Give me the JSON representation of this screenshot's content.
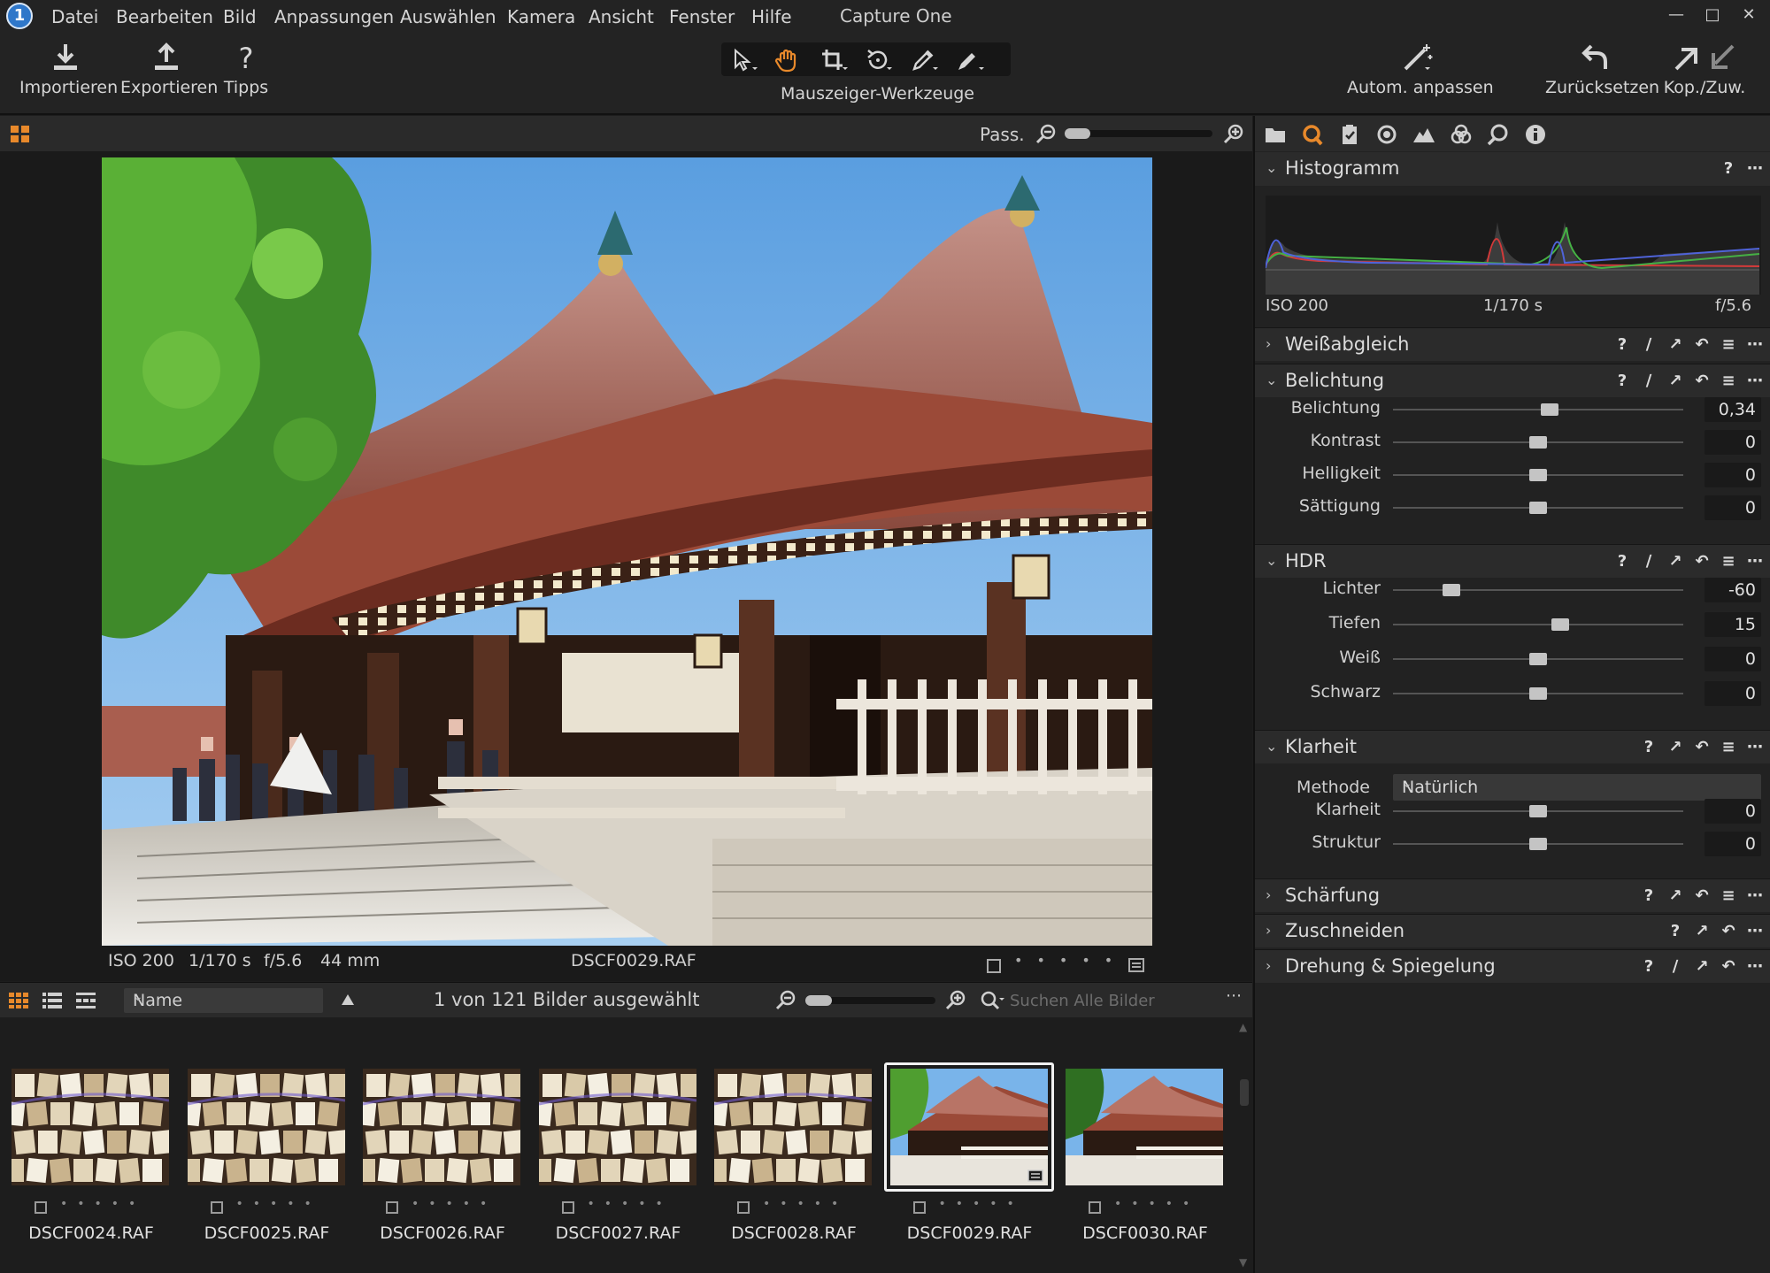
{
  "app": {
    "title": "Capture One",
    "logo": "1"
  },
  "menu": [
    "Datei",
    "Bearbeiten",
    "Bild",
    "Anpassungen",
    "Auswählen",
    "Kamera",
    "Ansicht",
    "Fenster",
    "Hilfe"
  ],
  "toolbar": {
    "import_label": "Importieren",
    "export_label": "Exportieren",
    "tips_label": "Tipps",
    "cursor_tools_label": "Mauszeiger-Werkzeuge",
    "auto_adjust_label": "Autom. anpassen",
    "reset_label": "Zurücksetzen",
    "copy_apply_label": "Kop./Zuw."
  },
  "viewer": {
    "fit_label": "Pass.",
    "zoom_level": 0.15,
    "info": {
      "iso": "ISO 200",
      "shutter": "1/170 s",
      "aperture": "f/5.6",
      "focal": "44 mm",
      "filename": "DSCF0029.RAF"
    }
  },
  "browser": {
    "sort_by": "Name",
    "selection_count": "1 von 121 Bilder ausgewählt",
    "search_placeholder": "Suchen Alle Bilder",
    "thumb_size": 0.15,
    "thumbnails": [
      {
        "name": "DSCF0024.RAF",
        "kind": "plaques"
      },
      {
        "name": "DSCF0025.RAF",
        "kind": "plaques"
      },
      {
        "name": "DSCF0026.RAF",
        "kind": "plaques"
      },
      {
        "name": "DSCF0027.RAF",
        "kind": "plaques"
      },
      {
        "name": "DSCF0028.RAF",
        "kind": "plaques"
      },
      {
        "name": "DSCF0029.RAF",
        "kind": "temple",
        "selected": true
      },
      {
        "name": "DSCF0030.RAF",
        "kind": "temple"
      }
    ]
  },
  "panel": {
    "histogram": {
      "title": "Histogramm",
      "iso": "ISO 200",
      "shutter": "1/170 s",
      "aperture": "f/5.6"
    },
    "white_balance": {
      "title": "Weißabgleich"
    },
    "exposure": {
      "title": "Belichtung",
      "rows": [
        {
          "label": "Belichtung",
          "value": "0,34",
          "pos": 0.54
        },
        {
          "label": "Kontrast",
          "value": "0",
          "pos": 0.5
        },
        {
          "label": "Helligkeit",
          "value": "0",
          "pos": 0.5
        },
        {
          "label": "Sättigung",
          "value": "0",
          "pos": 0.5
        }
      ]
    },
    "hdr": {
      "title": "HDR",
      "rows": [
        {
          "label": "Lichter",
          "value": "-60",
          "pos": 0.2
        },
        {
          "label": "Tiefen",
          "value": "15",
          "pos": 0.575
        },
        {
          "label": "Weiß",
          "value": "0",
          "pos": 0.5
        },
        {
          "label": "Schwarz",
          "value": "0",
          "pos": 0.5
        }
      ]
    },
    "clarity": {
      "title": "Klarheit",
      "method_label": "Methode",
      "method_value": "Natürlich",
      "rows": [
        {
          "label": "Klarheit",
          "value": "0",
          "pos": 0.5
        },
        {
          "label": "Struktur",
          "value": "0",
          "pos": 0.5
        }
      ]
    },
    "sharpening": {
      "title": "Schärfung"
    },
    "crop": {
      "title": "Zuschneiden"
    },
    "rotation": {
      "title": "Drehung & Spiegelung"
    }
  },
  "colors": {
    "accent": "#e8892b",
    "selection": "#f2f2f2",
    "panel_bg": "#222222"
  }
}
